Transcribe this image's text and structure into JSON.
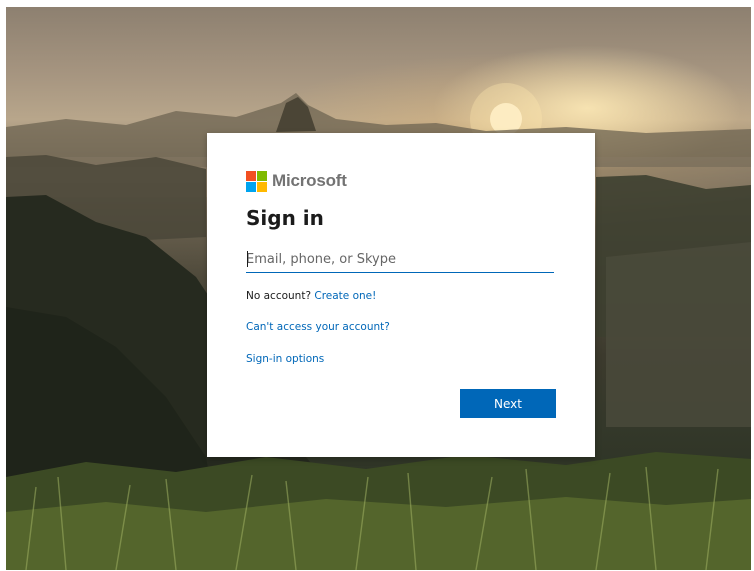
{
  "brand": {
    "name": "Microsoft",
    "logo_colors": [
      "#f25022",
      "#7fba00",
      "#00a4ef",
      "#ffb900"
    ]
  },
  "card": {
    "title": "Sign in"
  },
  "email_input": {
    "placeholder": "Email, phone, or Skype",
    "value": ""
  },
  "no_account": {
    "text": "No account?",
    "link_label": "Create one!"
  },
  "cant_access_label": "Can't access your account?",
  "signin_options_label": "Sign-in options",
  "next_button_label": "Next",
  "colors": {
    "accent": "#0067b8",
    "card_background": "#ffffff"
  },
  "background": "sunrise-mountain-landscape"
}
